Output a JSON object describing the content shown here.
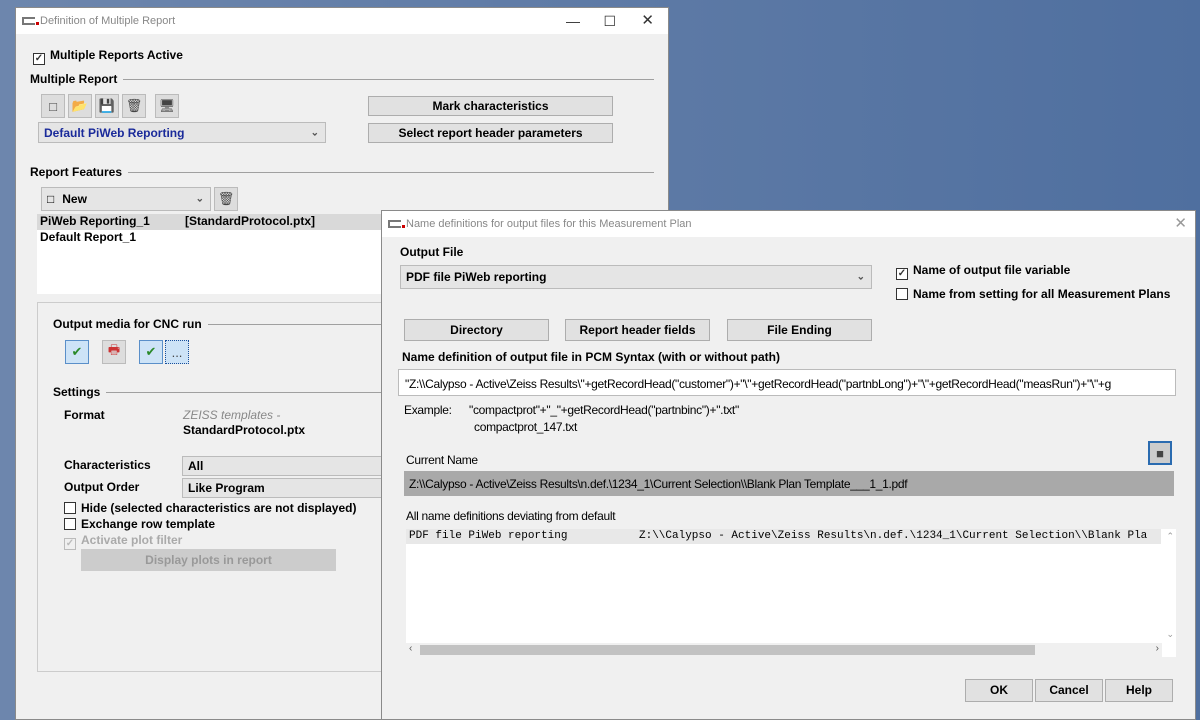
{
  "main": {
    "title": "Definition of Multiple Report",
    "multiple_active": "Multiple Reports Active",
    "multiple_report": "Multiple Report",
    "mark_chars": "Mark characteristics",
    "select_header": "Select report header parameters",
    "report_combo": "Default PiWeb Reporting",
    "report_features": "Report Features",
    "new_combo": "New",
    "list": [
      {
        "name": "PiWeb Reporting_1",
        "file": "[StandardProtocol.ptx]"
      },
      {
        "name": "Default Report_1",
        "file": ""
      }
    ],
    "output_media": "Output media for CNC run",
    "more": "...",
    "settings": "Settings",
    "format_label": "Format",
    "format_line1": "ZEISS templates -",
    "format_line2": "StandardProtocol.ptx",
    "chars_label": "Characteristics",
    "chars_value": "All",
    "order_label": "Output Order",
    "order_value": "Like Program",
    "hide": "Hide (selected characteristics are not displayed)",
    "exchange": "Exchange row template",
    "plot_filter": "Activate plot filter",
    "display_plots": "Display plots in report"
  },
  "dialog": {
    "title": "Name definitions for output files for this Measurement Plan",
    "output_file": "Output File",
    "output_combo": "PDF file PiWeb reporting",
    "name_variable": "Name of output file variable",
    "name_all": "Name from setting for all Measurement Plans",
    "directory": "Directory",
    "header_fields": "Report header fields",
    "file_ending": "File Ending",
    "pcm_label": "Name definition of output file in PCM Syntax (with or without path)",
    "pcm_value": "\"Z:\\\\Calypso - Active\\Zeiss Results\\\"+getRecordHead(\"customer\")+\"\\\"+getRecordHead(\"partnbLong\")+\"\\\"+getRecordHead(\"measRun\")+\"\\\"+g",
    "example_label": "Example:",
    "example_code": "\"compactprot\"+\"_\"+getRecordHead(\"partnbinc\")+\".txt\"",
    "example_result": "compactprot_147.txt",
    "current_label": "Current Name",
    "current_value": "Z:\\\\Calypso - Active\\Zeiss Results\\n.def.\\1234_1\\Current Selection\\\\Blank Plan Template___1_1.pdf",
    "deviating_label": "All name definitions deviating from default",
    "deviating_rows": [
      {
        "name": "PDF file PiWeb reporting",
        "path": "Z:\\\\Calypso - Active\\Zeiss Results\\n.def.\\1234_1\\Current Selection\\\\Blank Pla"
      }
    ],
    "ok": "OK",
    "cancel": "Cancel",
    "help": "Help"
  }
}
